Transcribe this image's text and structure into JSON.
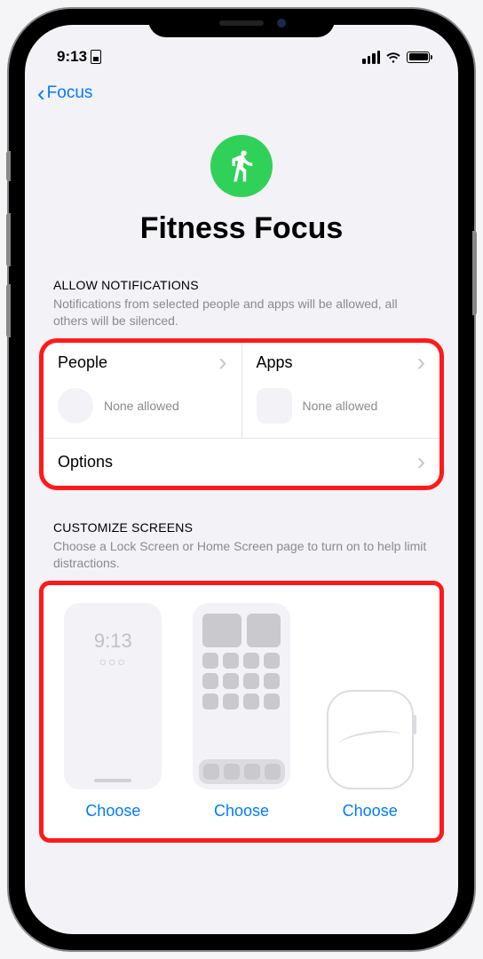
{
  "status": {
    "time": "9:13"
  },
  "nav": {
    "back": "Focus"
  },
  "hero": {
    "title": "Fitness Focus"
  },
  "sections": {
    "allow": {
      "header": "ALLOW NOTIFICATIONS",
      "desc": "Notifications from selected people and apps will be allowed, all others will be silenced.",
      "people_label": "People",
      "people_sub": "None allowed",
      "apps_label": "Apps",
      "apps_sub": "None allowed",
      "options_label": "Options"
    },
    "customize": {
      "header": "CUSTOMIZE SCREENS",
      "desc": "Choose a Lock Screen or Home Screen page to turn on to help limit distractions.",
      "lock_time": "9:13",
      "lock_dots": "○○○",
      "choose": "Choose"
    }
  },
  "colors": {
    "accent": "#007aff",
    "focus_green": "#30d158",
    "highlight": "#ff1a1a"
  }
}
